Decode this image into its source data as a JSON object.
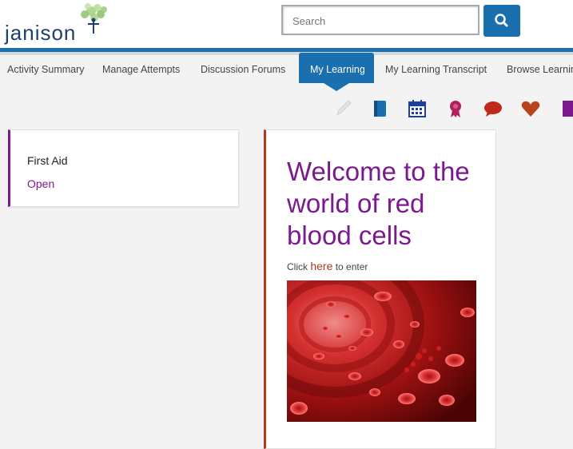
{
  "header": {
    "logo_text": "janison",
    "search_placeholder": "Search"
  },
  "nav": {
    "items": [
      {
        "label": "Activity Summary"
      },
      {
        "label": "Manage Attempts"
      },
      {
        "label": "Discussion Forums"
      },
      {
        "label": "My Learning",
        "active": true
      },
      {
        "label": "My Learning Transcript"
      },
      {
        "label": "Browse Learning"
      }
    ]
  },
  "toolbar_icons": [
    "pencil-icon",
    "book-icon",
    "calendar-icon",
    "award-icon",
    "chat-icon",
    "heart-icon",
    "bookmark-icon"
  ],
  "colors": {
    "brand_blue": "#1a6faf",
    "accent_purple": "#7b1a8f",
    "accent_rust": "#b03a1a"
  },
  "sidebar_card": {
    "title": "First Aid",
    "link": "Open"
  },
  "content": {
    "heading": "Welcome to the world of red blood cells",
    "click_prefix": "Click",
    "click_link": "here",
    "click_suffix": "to enter"
  }
}
